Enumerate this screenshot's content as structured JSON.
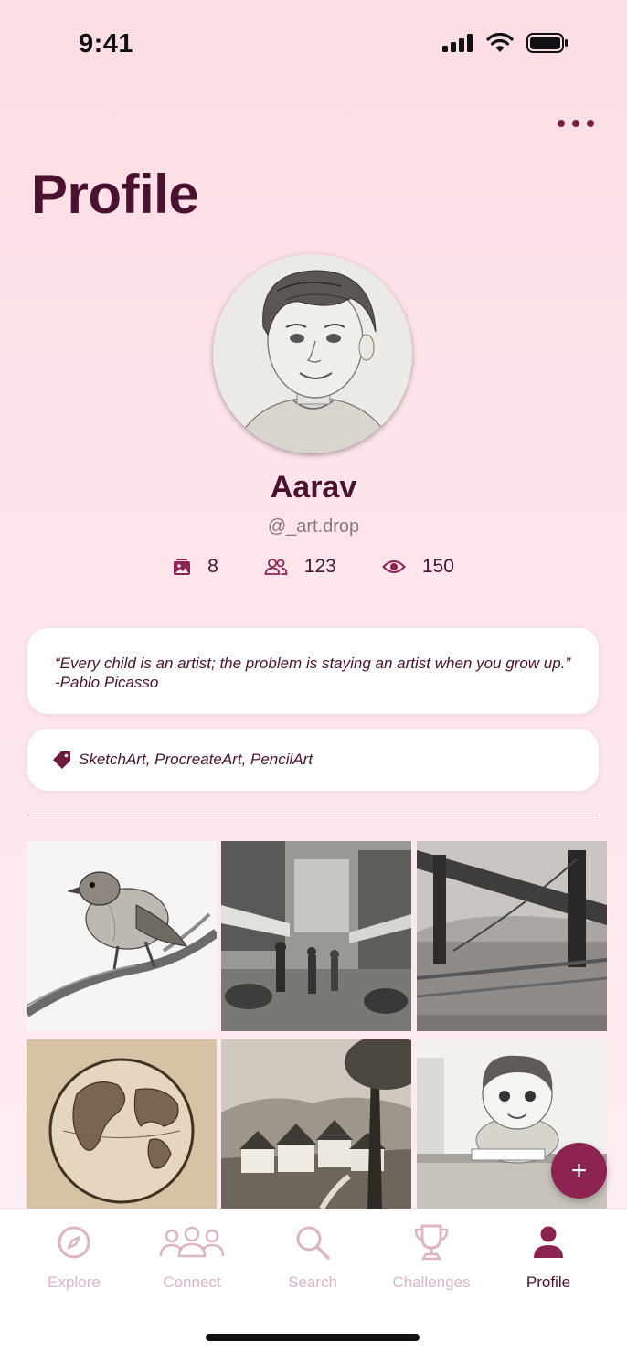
{
  "status_bar": {
    "time": "9:41"
  },
  "header": {
    "title": "Profile"
  },
  "profile": {
    "name": "Aarav",
    "handle": "@_art.drop",
    "stats": {
      "artworks": "8",
      "connections": "123",
      "views": "150"
    },
    "quote": "“Every child is an artist; the problem is staying an artist when you grow up.” -Pablo Picasso",
    "tags": "SketchArt, ProcreateArt, PencilArt"
  },
  "gallery": {
    "items": [
      "sparrow-sketch",
      "market-street-sketch",
      "bridge-sketch",
      "globe-sketch",
      "village-sketch",
      "boy-drawing-sketch"
    ]
  },
  "fab": {
    "label": "+"
  },
  "tab_bar": {
    "tabs": [
      {
        "label": "Explore",
        "icon": "compass-icon",
        "active": false
      },
      {
        "label": "Connect",
        "icon": "people-icon",
        "active": false
      },
      {
        "label": "Search",
        "icon": "search-icon",
        "active": false
      },
      {
        "label": "Challenges",
        "icon": "trophy-icon",
        "active": false
      },
      {
        "label": "Profile",
        "icon": "person-icon",
        "active": true
      }
    ]
  },
  "colors": {
    "accent": "#8c2350",
    "text_dark": "#4a1230",
    "tab_inactive": "#dcb4c4",
    "background": "#fddde4"
  }
}
